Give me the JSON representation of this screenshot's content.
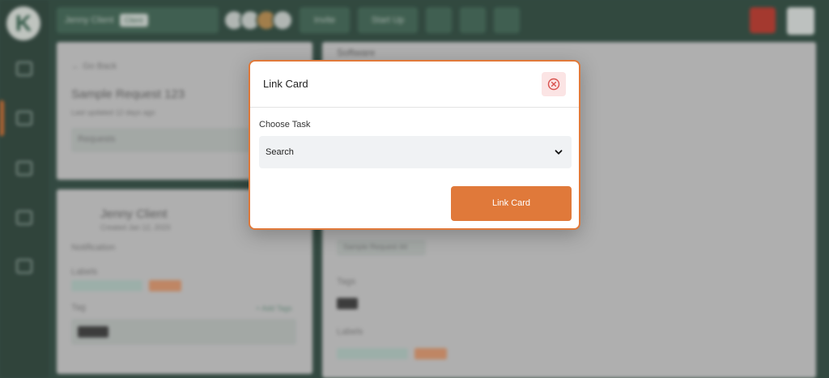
{
  "background": {
    "logo_letter": "K",
    "client_selector": {
      "label": "Jenny Client",
      "chip": "Client"
    },
    "toolbar_buttons": [
      "Invite",
      "Start Up"
    ],
    "left_panel": {
      "back_link": "← Go Back",
      "request_title": "Sample Request 123",
      "request_meta": "Last updated 12 days ago",
      "request_strip": "Requests"
    },
    "client_card": {
      "name": "Jenny Client",
      "meta": "Created Jan 12, 2023",
      "notification_label": "Notification",
      "labels_label": "Labels",
      "tag_label": "Tag",
      "add_tag": "+ Add Tags"
    },
    "right_panel": {
      "section_title": "Software",
      "request_chip": "Sample Request 44",
      "tags_label": "Tags",
      "labels_label": "Labels"
    }
  },
  "modal": {
    "title": "Link Card",
    "field_label": "Choose Task",
    "select_value": "Search",
    "submit_label": "Link Card"
  },
  "colors": {
    "accent": "#e0793a",
    "close_bg": "#fbe4e4",
    "close_icon": "#d9534f",
    "sidebar": "#3b5349"
  },
  "icons": {
    "close": "close-circle-icon",
    "select_arrow": "chevron-down-icon"
  }
}
